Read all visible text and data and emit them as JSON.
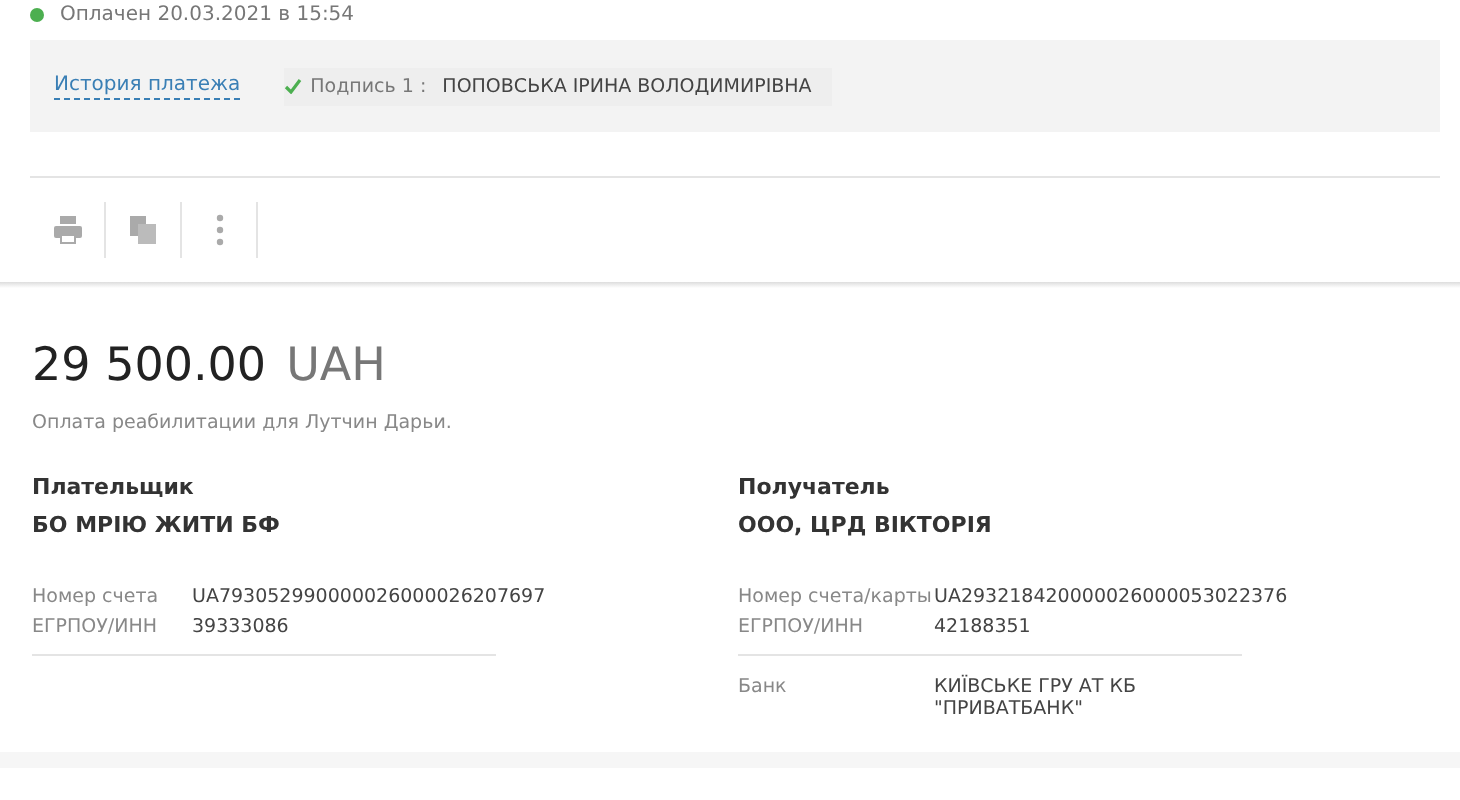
{
  "status": {
    "text": "Оплачен 20.03.2021 в 15:54",
    "paid": true
  },
  "history_link": "История платежа",
  "signatures": [
    {
      "label": "Подпись 1 :",
      "name": "ПОПОВСЬКА ІРИНА ВОЛОДИМИРІВНА",
      "signed": true
    }
  ],
  "toolbar": [
    {
      "kind": "print"
    },
    {
      "kind": "copy"
    },
    {
      "kind": "more"
    }
  ],
  "amount": {
    "value": "29 500.00",
    "currency": "UAH"
  },
  "purpose": "Оплата реабилитации для Лутчин Дарьи.",
  "parties": [
    {
      "role": "Плательщик",
      "name": "БО МРІЮ ЖИТИ БФ",
      "details": [
        {
          "label": "Номер счета",
          "value": "UA793052990000026000026207697"
        },
        {
          "label": "ЕГРПОУ/ИНН",
          "value": "39333086"
        }
      ]
    },
    {
      "role": "Получатель",
      "name": "ООО, ЦРД ВІКТОРІЯ",
      "details": [
        {
          "label": "Номер счета/карты",
          "value": "UA293218420000026000053022376"
        },
        {
          "label": "ЕГРПОУ/ИНН",
          "value": "42188351"
        }
      ],
      "bank": {
        "label": "Банк",
        "lines": [
          "КИЇВСЬКЕ ГРУ АТ КБ",
          "\"ПРИВАТБАНК\""
        ]
      }
    }
  ]
}
